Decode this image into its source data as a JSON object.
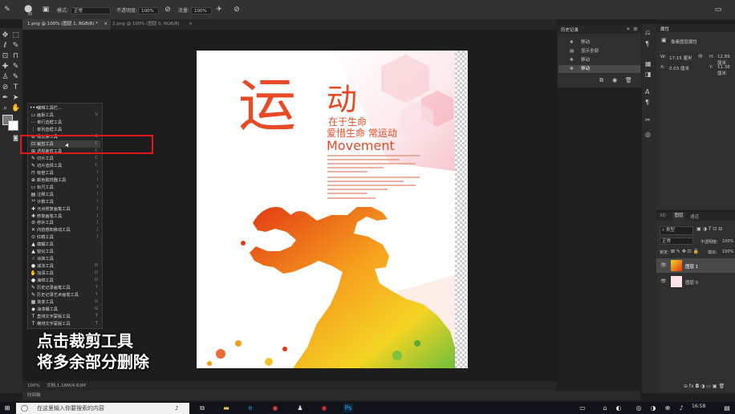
{
  "options_bar": {
    "mode_label": "模式:",
    "mode_value": "正常",
    "opacity_label": "不透明度:",
    "opacity_value": "100%",
    "flow_label": "流量:",
    "flow_value": "100%",
    "brush_size": "30"
  },
  "tabs": [
    {
      "label": "1.png @ 100% (图层 1, RGB/8) *",
      "close": "×"
    },
    {
      "label": "2.png @ 100% (图层 0, RGB/8)",
      "close": "×"
    }
  ],
  "poster": {
    "char_yun": "运",
    "char_dong": "动",
    "line1": "在于生命",
    "line2": "爱惜生命 常运动",
    "movement": "Movement"
  },
  "flyout": {
    "items": [
      {
        "glyph": "•••",
        "label": "编辑工具栏...",
        "key": ""
      },
      {
        "glyph": "▭",
        "label": "画板工具",
        "key": "V"
      },
      {
        "glyph": "⋯",
        "label": "单行选框工具",
        "key": ""
      },
      {
        "glyph": "⋮",
        "label": "单列选框工具",
        "key": ""
      },
      {
        "glyph": "⊘",
        "label": "橡皮擦工具",
        "key": "E"
      },
      {
        "glyph": "⊡",
        "label": "裁剪工具",
        "key": "C"
      },
      {
        "glyph": "⊞",
        "label": "透视裁剪工具",
        "key": "C"
      },
      {
        "glyph": "✎",
        "label": "切片工具",
        "key": "C"
      },
      {
        "glyph": "✎",
        "label": "切片选择工具",
        "key": "C"
      },
      {
        "glyph": "⊓",
        "label": "吸管工具",
        "key": "I"
      },
      {
        "glyph": "⊕",
        "label": "颜色取样器工具",
        "key": "I"
      },
      {
        "glyph": "▭",
        "label": "标尺工具",
        "key": "I"
      },
      {
        "glyph": "▤",
        "label": "注释工具",
        "key": "I"
      },
      {
        "glyph": "¹²",
        "label": "计数工具",
        "key": "I"
      },
      {
        "glyph": "✚",
        "label": "污点修复画笔工具",
        "key": "J"
      },
      {
        "glyph": "✚",
        "label": "修复画笔工具",
        "key": "J"
      },
      {
        "glyph": "⊜",
        "label": "修补工具",
        "key": "J"
      },
      {
        "glyph": "✕",
        "label": "内容感知移动工具",
        "key": "J"
      },
      {
        "glyph": "⊙",
        "label": "红眼工具",
        "key": "J"
      },
      {
        "glyph": "▲",
        "label": "模糊工具",
        "key": ""
      },
      {
        "glyph": "▲",
        "label": "锐化工具",
        "key": ""
      },
      {
        "glyph": "☝",
        "label": "涂抹工具",
        "key": ""
      },
      {
        "glyph": "●",
        "label": "减淡工具",
        "key": "O"
      },
      {
        "glyph": "✋",
        "label": "加深工具",
        "key": "O"
      },
      {
        "glyph": "●",
        "label": "海绵工具",
        "key": "O"
      },
      {
        "glyph": "✎",
        "label": "历史记录画笔工具",
        "key": "Y"
      },
      {
        "glyph": "✎",
        "label": "历史记录艺术画笔工具",
        "key": "Y"
      },
      {
        "glyph": "▦",
        "label": "渐变工具",
        "key": "G"
      },
      {
        "glyph": "◆",
        "label": "油漆桶工具",
        "key": "G"
      },
      {
        "glyph": "T",
        "label": "直排文字蒙版工具",
        "key": "T"
      },
      {
        "glyph": "T",
        "label": "横排文字蒙版工具",
        "key": "T"
      }
    ]
  },
  "subtitle": {
    "line1": "点击裁剪工具",
    "line2": "将多余部分删除"
  },
  "history": {
    "title": "历史记录",
    "items": [
      "移动",
      "显示全部",
      "移动",
      "移动"
    ]
  },
  "properties": {
    "title": "属性",
    "subtitle": "像素图层属性",
    "w_label": "W:",
    "w_value": "17.15 厘米",
    "h_label": "H:",
    "h_value": "12.89 厘米",
    "x_label": "X:",
    "x_value": "0.03 厘米",
    "y_label": "Y:",
    "y_value": "11.38 厘米"
  },
  "layers": {
    "tabs": [
      "3D",
      "图层",
      "通道"
    ],
    "kind_label": "类型",
    "blend_mode": "正常",
    "opacity_label": "不透明度:",
    "opacity_value": "100%",
    "lock_label": "锁定:",
    "fill_label": "填充:",
    "fill_value": "100%",
    "rows": [
      {
        "name": "图层 1"
      },
      {
        "name": "图层 0"
      }
    ]
  },
  "status": {
    "zoom": "100%",
    "doc_info": "文档:1.16M/4.63M"
  },
  "timeline": {
    "label": "时间轴"
  },
  "taskbar": {
    "search_placeholder": "在这里输入你要搜索的内容",
    "time": "16:58",
    "date": "2019/..."
  },
  "colors": {
    "highlight_box": "#e3181e",
    "title_red": "#e84a26",
    "taskbar": "#101318"
  }
}
